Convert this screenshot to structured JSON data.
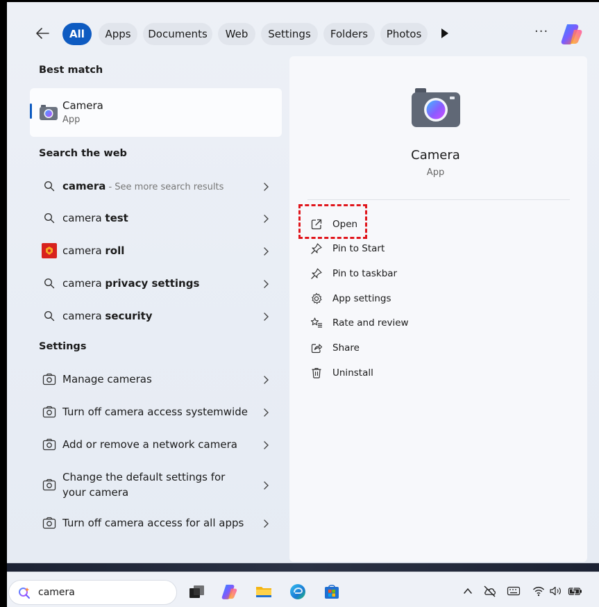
{
  "filters": {
    "items": [
      "All",
      "Apps",
      "Documents",
      "Web",
      "Settings",
      "Folders",
      "Photos"
    ],
    "active": "All",
    "more": "···"
  },
  "left": {
    "best_match_title": "Best match",
    "best_match": {
      "title": "Camera",
      "subtitle": "App"
    },
    "web_title": "Search the web",
    "web_results": [
      {
        "plain": "camera",
        "bold": "",
        "muted": " - See more search results"
      },
      {
        "plain": "camera ",
        "bold": "test",
        "muted": ""
      },
      {
        "plain": "camera ",
        "bold": "roll",
        "muted": ""
      },
      {
        "plain": "camera ",
        "bold": "privacy settings",
        "muted": ""
      },
      {
        "plain": "camera ",
        "bold": "security",
        "muted": ""
      }
    ],
    "settings_title": "Settings",
    "settings_results": [
      "Manage cameras",
      "Turn off camera access systemwide",
      "Add or remove a network camera",
      "Change the default settings for your camera",
      "Turn off camera access for all apps"
    ]
  },
  "details": {
    "title": "Camera",
    "subtitle": "App",
    "actions": [
      "Open",
      "Pin to Start",
      "Pin to taskbar",
      "App settings",
      "Rate and review",
      "Share",
      "Uninstall"
    ]
  },
  "taskbar": {
    "search_value": "camera",
    "apps": [
      "task-view-icon",
      "copilot-icon",
      "file-explorer-icon",
      "edge-icon",
      "store-icon"
    ],
    "tray": [
      "chevron-up-icon",
      "cloud-off-icon",
      "keyboard-icon",
      "wifi-icon",
      "volume-icon",
      "battery-icon"
    ]
  },
  "colors": {
    "accent": "#0e5bc1",
    "highlight": "#e0151b"
  }
}
